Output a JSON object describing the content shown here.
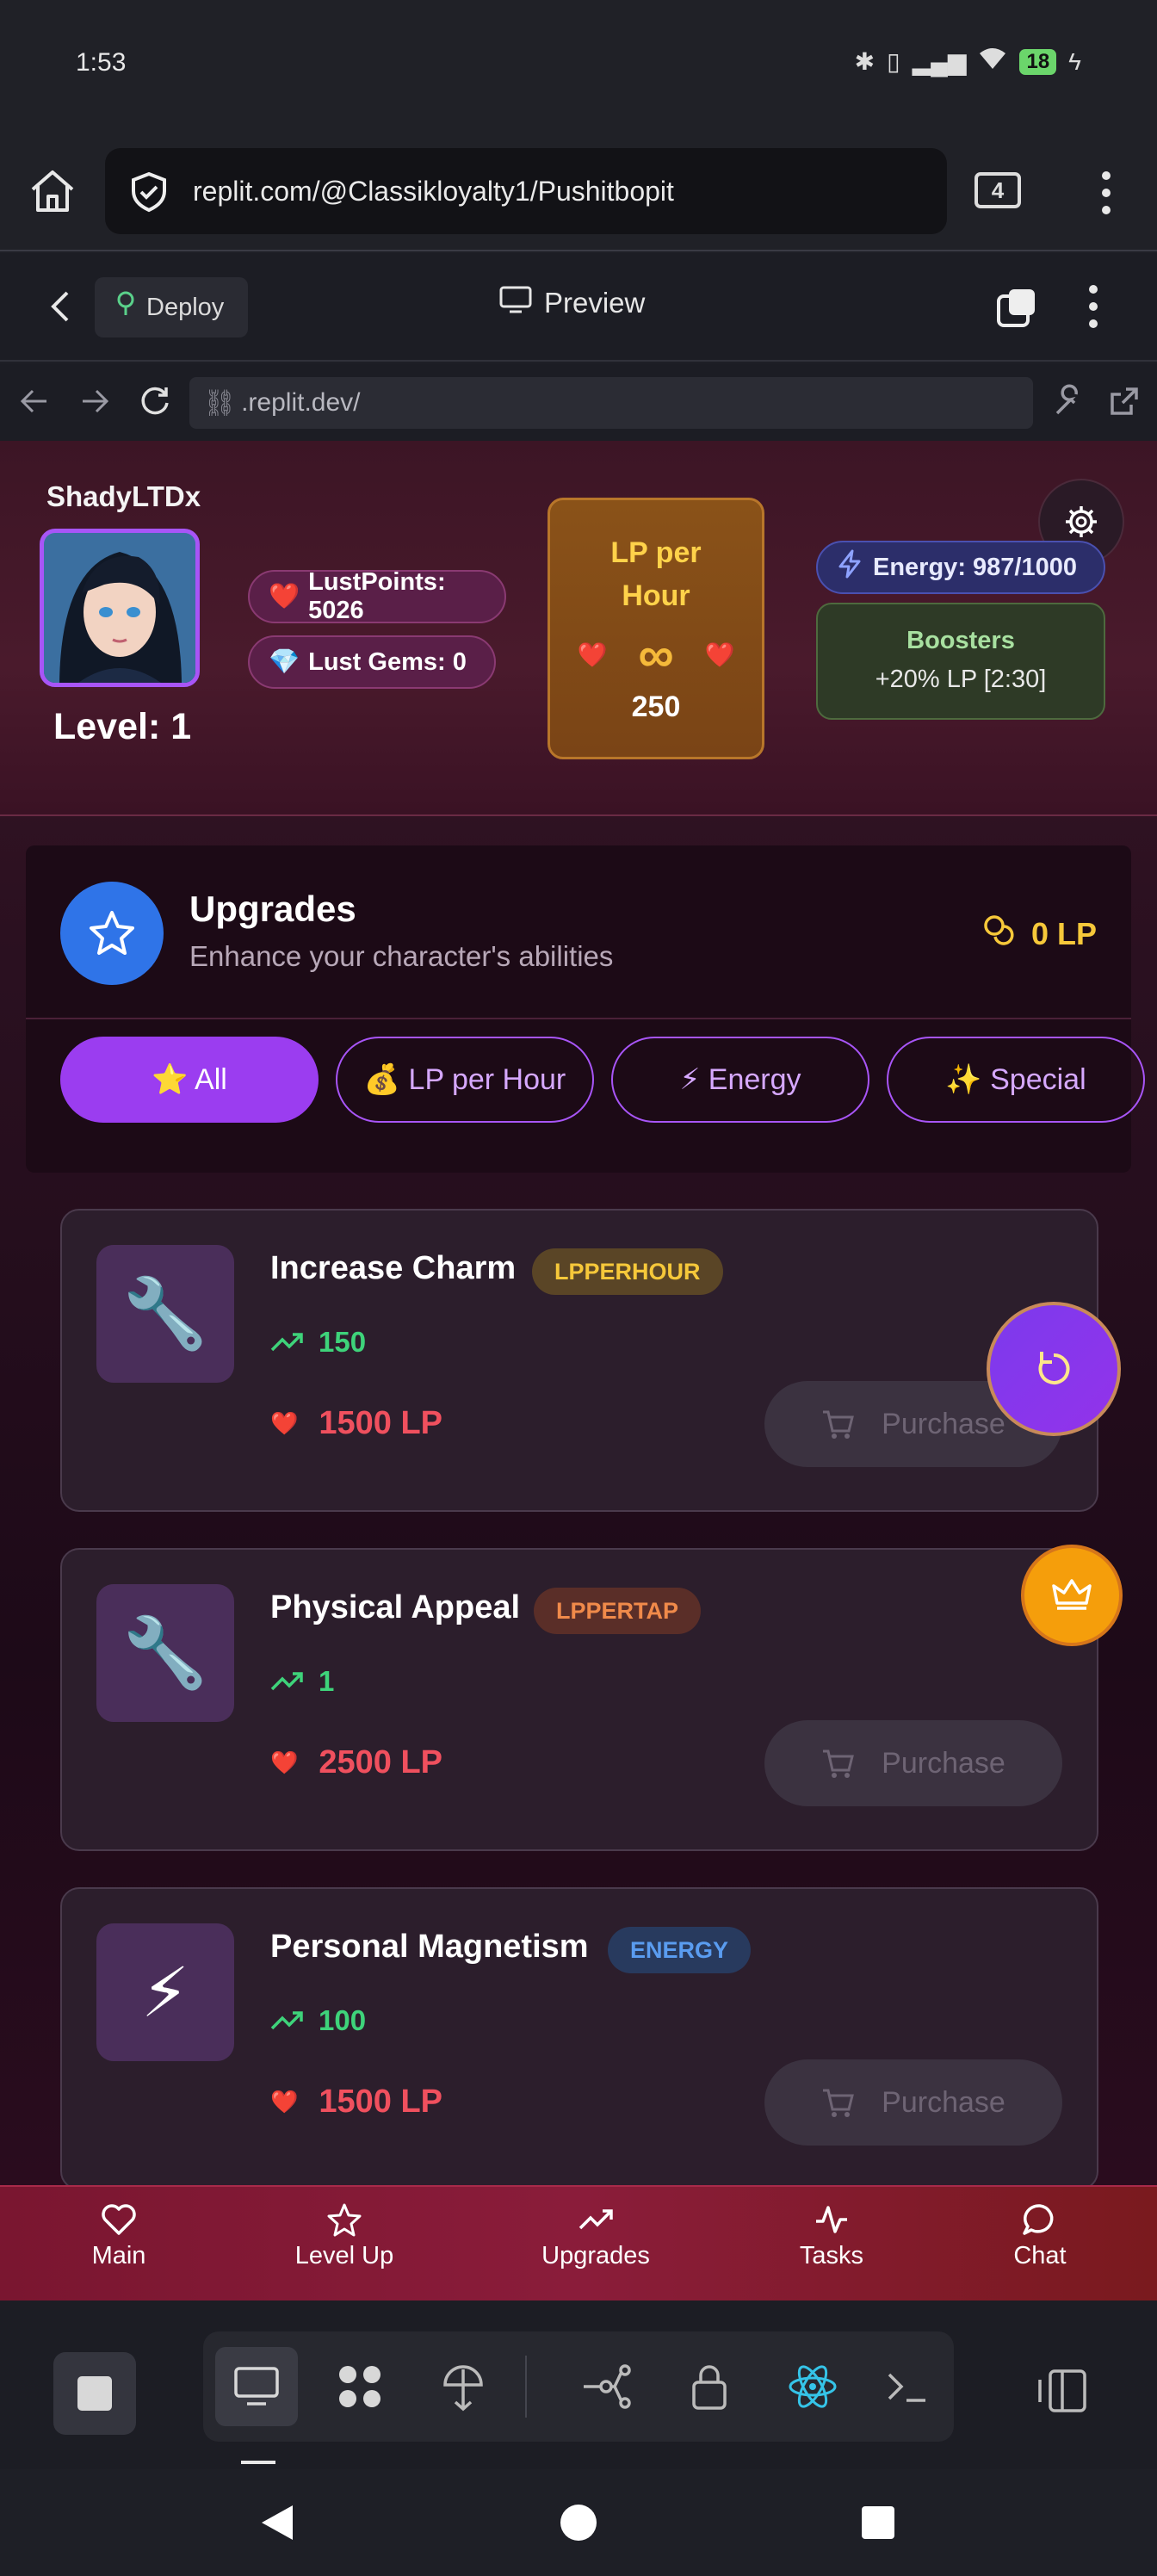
{
  "status_bar": {
    "time": "1:53",
    "battery": "18",
    "icons": [
      "bluetooth-icon",
      "vibrate-icon",
      "signal-icon",
      "wifi-icon",
      "battery-icon"
    ]
  },
  "browser": {
    "url": "replit.com/@Classikloyalty1/Pushitbopit",
    "tab_count": "4"
  },
  "replit_bar": {
    "deploy_label": "Deploy",
    "preview_label": "Preview"
  },
  "webview": {
    "url": ".replit.dev/"
  },
  "header": {
    "username": "ShadyLTDx",
    "level_text": "Level: 1",
    "lust_points": "LustPoints: 5026",
    "lust_gems": "Lust Gems: 0",
    "lph_title": "LP per Hour",
    "lph_symbol": "∞",
    "lph_value": "250",
    "energy": "Energy: 987/1000",
    "boosters_title": "Boosters",
    "boosters_text": "+20% LP [2:30]"
  },
  "upgrades": {
    "title": "Upgrades",
    "subtitle": "Enhance your character's abilities",
    "lp_balance": "0 LP",
    "filters": [
      {
        "label": "⭐ All",
        "active": true
      },
      {
        "label": "💰 LP per Hour",
        "active": false
      },
      {
        "label": "⚡ Energy",
        "active": false
      },
      {
        "label": "✨ Special",
        "active": false
      }
    ],
    "items": [
      {
        "name": "Increase Charm",
        "tag": "LPPERHOUR",
        "value": "150",
        "cost": "1500 LP",
        "icon": "🔧",
        "purchase": "Purchase"
      },
      {
        "name": "Physical Appeal",
        "tag": "LPPERTAP",
        "value": "1",
        "cost": "2500 LP",
        "icon": "🔧",
        "purchase": "Purchase"
      },
      {
        "name": "Personal Magnetism",
        "tag": "ENERGY",
        "value": "100",
        "cost": "1500 LP",
        "icon": "⚡",
        "purchase": "Purchase"
      }
    ]
  },
  "app_nav": [
    {
      "label": "Main",
      "icon": "heart-icon"
    },
    {
      "label": "Level Up",
      "icon": "star-icon"
    },
    {
      "label": "Upgrades",
      "icon": "trending-up-icon",
      "active": true
    },
    {
      "label": "Tasks",
      "icon": "activity-icon"
    },
    {
      "label": "Chat",
      "icon": "chat-bubble-icon"
    }
  ],
  "colors": {
    "accent_purple": "#9b3df0",
    "lp_gold": "#f6c83a",
    "cost_red": "#f0505e",
    "stat_green": "#3ed37a",
    "nav_red": "#8a1c3a"
  }
}
